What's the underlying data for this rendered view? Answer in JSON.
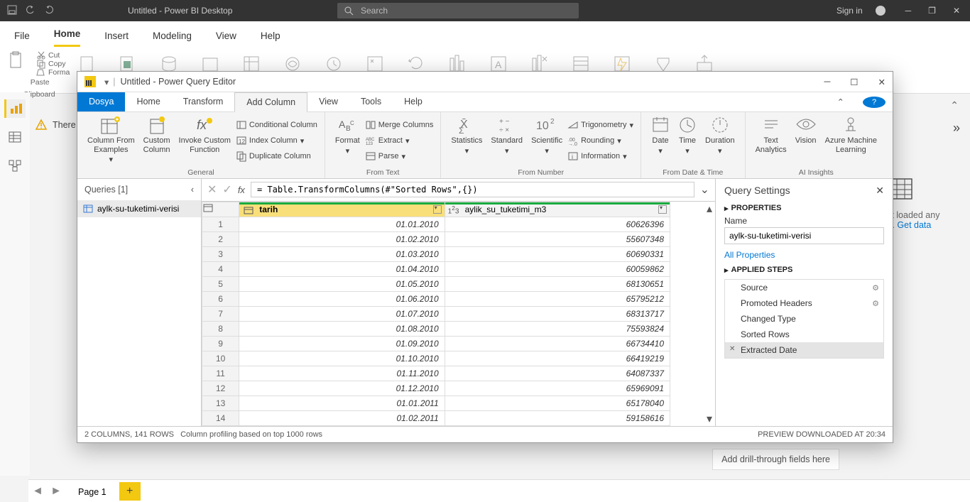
{
  "titlebar": {
    "title": "Untitled - Power BI Desktop",
    "search": "Search",
    "signin": "Sign in"
  },
  "main_tabs": [
    "File",
    "Home",
    "Insert",
    "Modeling",
    "View",
    "Help"
  ],
  "main_tabs_active": 1,
  "clipboard": {
    "paste": "Paste",
    "cut": "Cut",
    "copy": "Copy",
    "fmt": "Forma",
    "group": "Clipboard"
  },
  "leftnav": [
    "report",
    "data",
    "model"
  ],
  "warn_text": "There",
  "bg_right": {
    "l1": "n't loaded any",
    "l2": "et.",
    "link": "Get data"
  },
  "drill": "Add drill-through fields here",
  "sheets": {
    "page": "Page 1"
  },
  "pqe": {
    "title": "Untitled - Power Query Editor",
    "menutabs": [
      "Dosya",
      "Home",
      "Transform",
      "Add Column",
      "View",
      "Tools",
      "Help"
    ],
    "menutabs_active": 3,
    "ribbon_groups": {
      "general": {
        "label": "General",
        "examples": "Column From\nExamples",
        "custom": "Custom\nColumn",
        "invoke": "Invoke Custom\nFunction",
        "cond": "Conditional Column",
        "index": "Index Column",
        "dup": "Duplicate Column"
      },
      "fromtext": {
        "label": "From Text",
        "format": "Format",
        "merge": "Merge Columns",
        "extract": "Extract",
        "parse": "Parse"
      },
      "fromnumber": {
        "label": "From Number",
        "stats": "Statistics",
        "standard": "Standard",
        "sci": "Scientific",
        "trig": "Trigonometry",
        "round": "Rounding",
        "info": "Information"
      },
      "fromdate": {
        "label": "From Date & Time",
        "date": "Date",
        "time": "Time",
        "dur": "Duration"
      },
      "ai": {
        "label": "AI Insights",
        "text": "Text\nAnalytics",
        "vision": "Vision",
        "azure": "Azure Machine\nLearning"
      }
    },
    "queries_header": "Queries [1]",
    "query_name": "aylk-su-tuketimi-verisi",
    "formula": "= Table.TransformColumns(#\"Sorted Rows\",{})",
    "columns": [
      "tarih",
      "aylik_su_tuketimi_m3"
    ],
    "rows": [
      [
        "01.01.2010",
        "60626396"
      ],
      [
        "01.02.2010",
        "55607348"
      ],
      [
        "01.03.2010",
        "60690331"
      ],
      [
        "01.04.2010",
        "60059862"
      ],
      [
        "01.05.2010",
        "68130651"
      ],
      [
        "01.06.2010",
        "65795212"
      ],
      [
        "01.07.2010",
        "68313717"
      ],
      [
        "01.08.2010",
        "75593824"
      ],
      [
        "01.09.2010",
        "66734410"
      ],
      [
        "01.10.2010",
        "66419219"
      ],
      [
        "01.11.2010",
        "64087337"
      ],
      [
        "01.12.2010",
        "65969091"
      ],
      [
        "01.01.2011",
        "65178040"
      ],
      [
        "01.02.2011",
        "59158616"
      ]
    ],
    "settings": {
      "title": "Query Settings",
      "props": "PROPERTIES",
      "name": "Name",
      "name_val": "aylk-su-tuketimi-verisi",
      "allprops": "All Properties",
      "applied": "APPLIED STEPS",
      "steps": [
        "Source",
        "Promoted Headers",
        "Changed Type",
        "Sorted Rows",
        "Extracted Date"
      ],
      "active_step": 4
    },
    "status": {
      "left": "2 COLUMNS, 141 ROWS",
      "mid": "Column profiling based on top 1000 rows",
      "right": "PREVIEW DOWNLOADED AT 20:34"
    }
  }
}
